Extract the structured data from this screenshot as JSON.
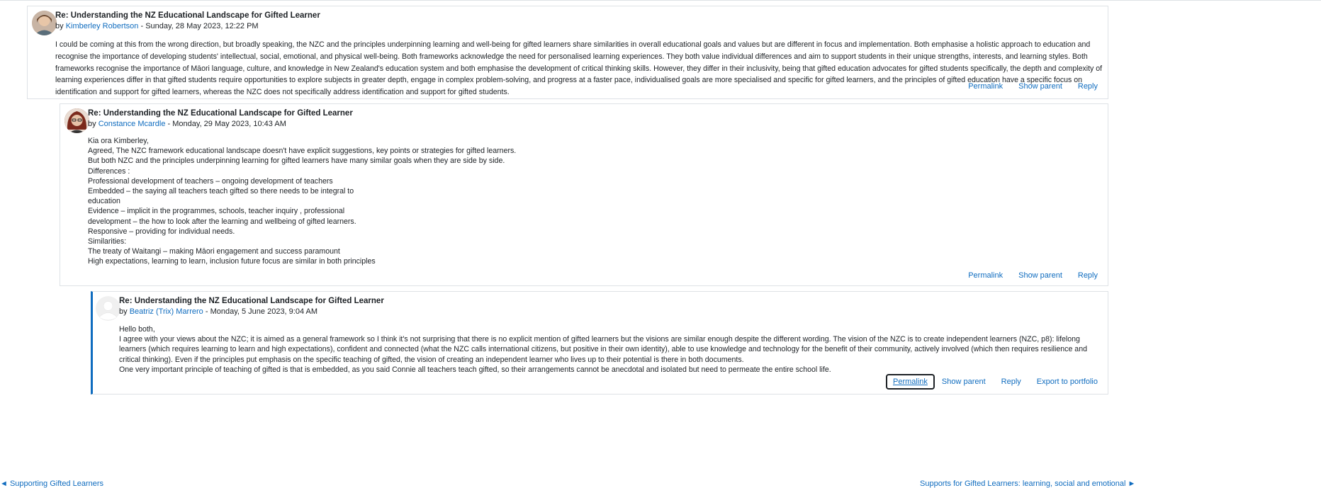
{
  "posts": [
    {
      "subject": "Re: Understanding the NZ Educational Landscape for Gifted Learner",
      "by": "by",
      "author": "Kimberley Robertson",
      "date": "- Sunday, 28 May 2023, 12:22 PM",
      "paragraphs": [
        "I could be coming at this from the wrong direction, but broadly speaking, the NZC and the principles underpinning learning and well-being for gifted learners share similarities in overall educational goals and values but are different in focus and implementation. Both emphasise a holistic approach to education and recognise the importance of developing students' intellectual, social, emotional, and physical well-being. Both frameworks acknowledge the need for personalised learning experiences. They both value individual differences and aim to support students in their unique strengths, interests, and learning styles. Both frameworks recognise the importance of Māori language, culture, and knowledge in New Zealand's education system and both emphasise the development of critical thinking skills. However, they differ in their inclusivity, being that gifted education advocates for gifted students specifically, the depth and complexity of learning experiences differ in that gifted students require opportunities to explore subjects in greater depth, engage in complex problem-solving, and progress at a faster pace, individualised goals are more specialised and specific for gifted learners, and the principles of gifted education have a specific focus on identification and support for gifted learners, whereas the NZC does not specifically address identification and support for gifted students."
      ],
      "actions": [
        "Permalink",
        "Show parent",
        "Reply"
      ]
    },
    {
      "subject": "Re: Understanding the NZ Educational Landscape for Gifted Learner",
      "by": "by",
      "author": "Constance Mcardle",
      "date": "- Monday, 29 May 2023, 10:43 AM",
      "paragraphs": [
        "Kia ora Kimberley,",
        "Agreed, The NZC framework educational landscape doesn't have explicit suggestions, key points or strategies for gifted learners.",
        "But both NZC and the principles underpinning learning for gifted learners have many similar goals when they are side by side.",
        "Differences :",
        "Professional development of teachers – ongoing development of teachers",
        "Embedded – the saying all teachers teach gifted so there needs to be integral to",
        "education",
        "Evidence – implicit in the programmes, schools, teacher inquiry , professional",
        "development – the how to look after the learning and wellbeing of gifted learners.",
        "Responsive – providing for individual needs.",
        "Similarities:",
        "The treaty of Waitangi – making Māori engagement and success paramount",
        "High expectations, learning to learn, inclusion future focus are similar in both principles"
      ],
      "actions": [
        "Permalink",
        "Show parent",
        "Reply"
      ]
    },
    {
      "subject": "Re: Understanding the NZ Educational Landscape for Gifted Learner",
      "by": "by",
      "author": "Beatriz (Trix) Marrero",
      "date": "- Monday, 5 June 2023, 9:04 AM",
      "paragraphs": [
        "Hello both,",
        "I agree with your views about the NZC; it is aimed as a general framework so I think it's not surprising that there is no explicit mention of gifted learners but the visions are similar enough despite the different wording. The vision of the NZC is to create independent learners (NZC, p8): lifelong learners (which requires learning to learn and high expectations), confident and connected (what the NZC calls international citizens, but positive in their own identity), able to use knowledge and technology for the benefit of their community, actively involved (which then requires resilience and critical thinking). Even if the principles put emphasis on the specific teaching of gifted, the vision of creating an independent learner who lives up to their potential is there in both documents.",
        "One very important principle of teaching of gifted is that is embedded, as you said Connie all teachers teach gifted, so their arrangements cannot be anecdotal and isolated but need to permeate the entire school life."
      ],
      "actions": [
        "Permalink",
        "Show parent",
        "Reply",
        "Export to portfolio"
      ]
    }
  ],
  "nav": {
    "prev": "◄ Supporting Gifted Learners",
    "next": "Supports for Gifted Learners: learning, social and emotional ►"
  },
  "colors": {
    "link": "#0f6cbf",
    "border": "#dee2e6",
    "accent": "#0f6cbf"
  },
  "icons": {
    "avatar_default": "user-silhouette-icon"
  }
}
